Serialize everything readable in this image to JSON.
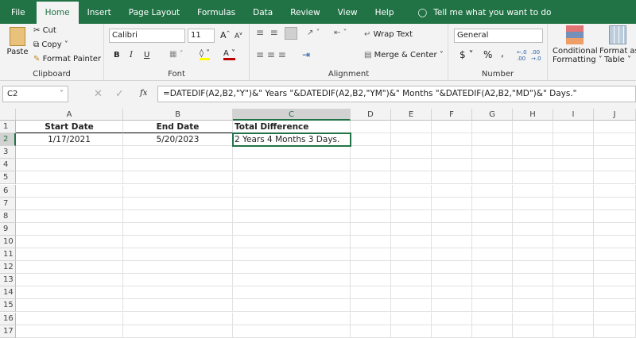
{
  "tabs": [
    "File",
    "Home",
    "Insert",
    "Page Layout",
    "Formulas",
    "Data",
    "Review",
    "View",
    "Help"
  ],
  "tell_me": "Tell me what you want to do",
  "clipboard": {
    "paste": "Paste",
    "cut": "Cut",
    "copy": "Copy",
    "format_painter": "Format Painter",
    "label": "Clipboard"
  },
  "font": {
    "name": "Calibri",
    "size": "11",
    "bold": "B",
    "italic": "I",
    "underline": "U",
    "label": "Font"
  },
  "alignment": {
    "wrap_text": "Wrap Text",
    "merge_center": "Merge & Center",
    "label": "Alignment"
  },
  "number": {
    "format": "General",
    "currency": "$",
    "percent": "%",
    "comma": ",",
    "label": "Number"
  },
  "styles": {
    "conditional": "Conditional",
    "formatting": "Formatting",
    "format_as": "Format as",
    "table": "Table"
  },
  "formula_bar": {
    "name_box": "C2",
    "fx": "fx",
    "formula": "=DATEDIF(A2,B2,\"Y\")&\" Years \"&DATEDIF(A2,B2,\"YM\")&\" Months \"&DATEDIF(A2,B2,\"MD\")&\" Days.\""
  },
  "columns": [
    "A",
    "B",
    "C",
    "D",
    "E",
    "F",
    "G",
    "H",
    "I",
    "J"
  ],
  "rows": [
    "1",
    "2",
    "3",
    "4",
    "5",
    "6",
    "7",
    "8",
    "9",
    "10",
    "11",
    "12",
    "13",
    "14",
    "15",
    "16",
    "17"
  ],
  "cells": {
    "A1": "Start Date",
    "B1": "End Date",
    "C1": "Total Difference",
    "A2": "1/17/2021",
    "B2": "5/20/2023",
    "C2": "2 Years 4 Months 3 Days."
  },
  "accent": "#217346"
}
